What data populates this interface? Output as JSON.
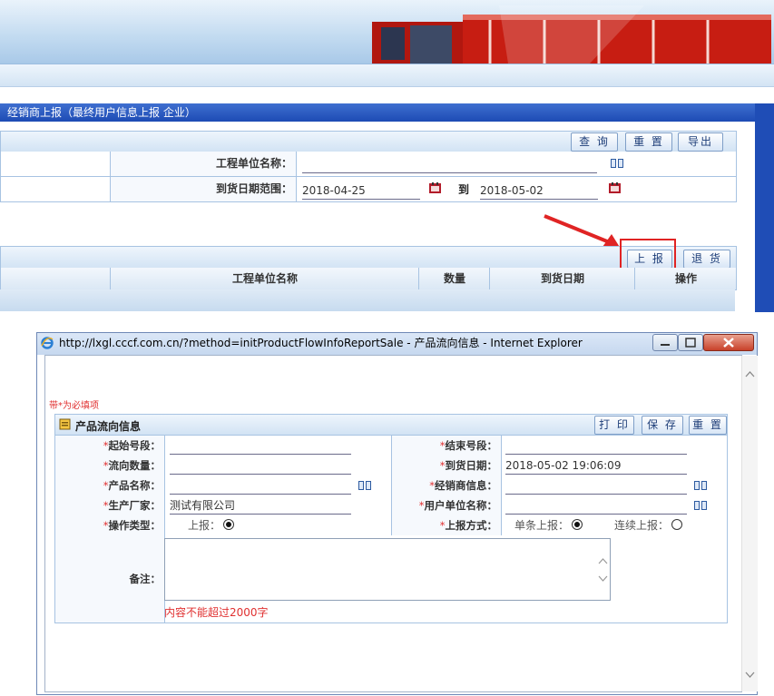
{
  "title_bar": "经销商上报（最终用户信息上报 企业）",
  "query": {
    "buttons": [
      "查 询",
      "重 置",
      "导出"
    ],
    "project_unit_label": "工程单位名称：",
    "project_unit_value": "",
    "date_range_label": "到货日期范围：",
    "date_from": "2018-04-25",
    "date_to_sep": "到",
    "date_to": "2018-05-02"
  },
  "list": {
    "buttons": [
      "上 报",
      "退 货"
    ],
    "columns": [
      "工程单位名称",
      "数量",
      "到货日期",
      "操作"
    ]
  },
  "popup": {
    "window_title": "http://lxgl.cccf.com.cn/?method=initProductFlowInfoReportSale - 产品流向信息 - Internet Explorer",
    "required_note": "带*为必填项",
    "section_title": "产品流向信息",
    "buttons": [
      "打 印",
      "保 存",
      "重 置"
    ],
    "fields": {
      "start_no_label": "起始号段：",
      "end_no_label": "结束号段：",
      "flow_qty_label": "流向数量：",
      "arrival_date_label": "到货日期：",
      "arrival_date_value": "2018-05-02 19:06:09",
      "product_name_label": "产品名称：",
      "dealer_info_label": "经销商信息：",
      "manufacturer_label": "生产厂家：",
      "manufacturer_value": "测试有限公司",
      "user_unit_label": "用户单位名称：",
      "op_type_label": "操作类型：",
      "op_type_option": "上报：",
      "report_mode_label": "上报方式：",
      "report_mode_single": "单条上报：",
      "report_mode_multi": "连续上报：",
      "remark_label": "备注：",
      "remark_warning": "内容不能超过2000字"
    }
  },
  "colors": {
    "title_blue": "#1d4bb4",
    "required_red": "#e03030",
    "highlight_red": "#e02424"
  },
  "icons": [
    "ie-logo-icon",
    "book-lookup-icon",
    "calendar-icon",
    "minimize-icon",
    "maximize-icon",
    "close-icon",
    "red-arrow-icon"
  ]
}
